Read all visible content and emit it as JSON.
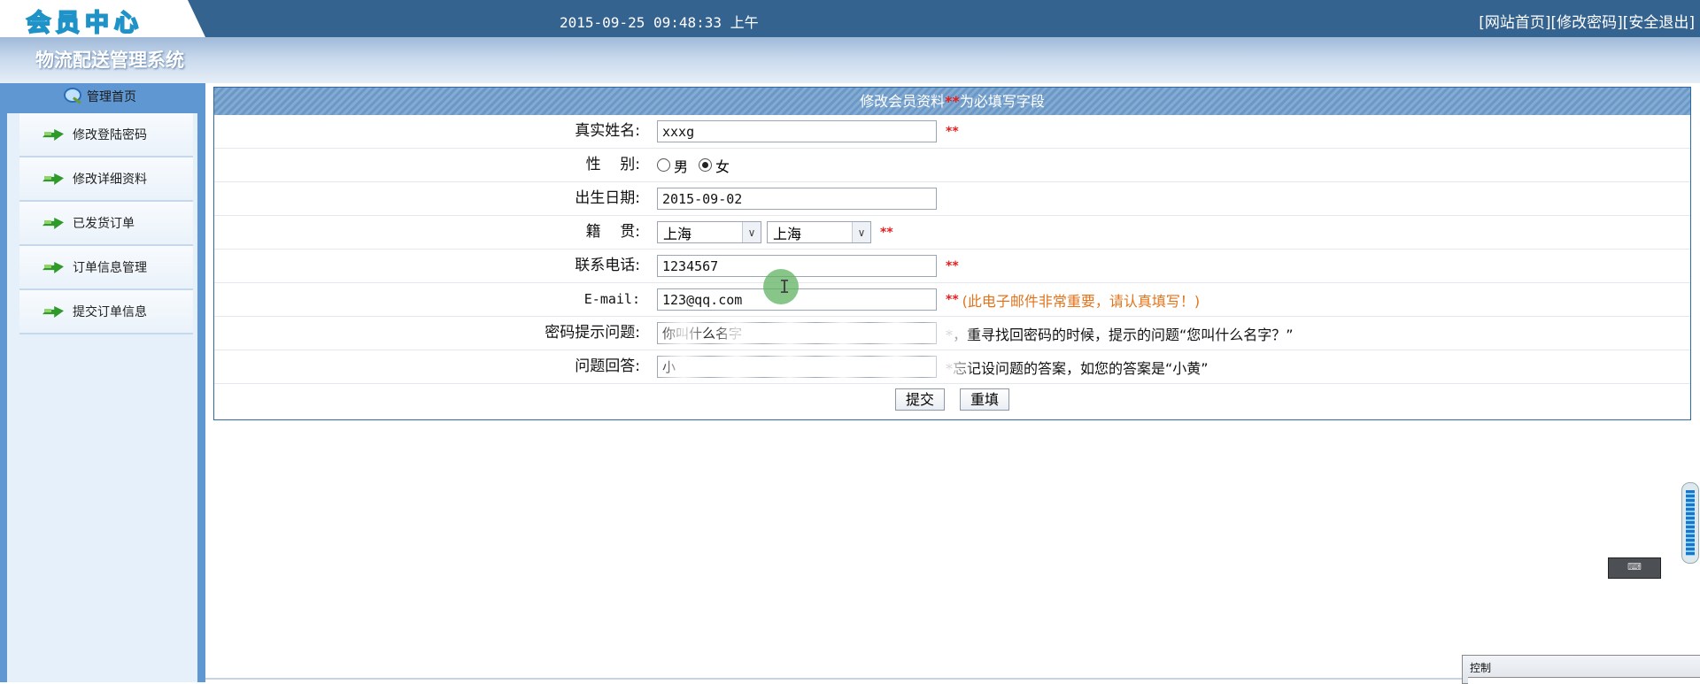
{
  "header": {
    "logo_text": "会员中心",
    "datetime": "2015-09-25 09:48:33 上午",
    "links": [
      "[网站首页]",
      "[修改密码]",
      "[安全退出]"
    ]
  },
  "system_title": "物流配送管理系统",
  "sidebar": {
    "home_label": "管理首页",
    "items": [
      {
        "label": "修改登陆密码"
      },
      {
        "label": "修改详细资料"
      },
      {
        "label": "已发货订单"
      },
      {
        "label": "订单信息管理"
      },
      {
        "label": "提交订单信息"
      }
    ]
  },
  "form": {
    "header_text": "修改会员资料",
    "header_req_mark": "**",
    "header_suffix": "为必填写字段",
    "req_mark": "**",
    "fields": {
      "real_name": {
        "label": "真实姓名:",
        "value": "xxxg"
      },
      "gender": {
        "label": "性    别:",
        "options": [
          "男",
          "女"
        ],
        "selected": "女"
      },
      "birth_date": {
        "label": "出生日期:",
        "value": "2015-09-02"
      },
      "native_place": {
        "label": "籍    贯:",
        "province": "上海",
        "city": "上海"
      },
      "phone": {
        "label": "联系电话:",
        "value": "1234567"
      },
      "email": {
        "label": "E-mail:",
        "value": "123@qq.com",
        "hint": "(此电子邮件非常重要，请认真填写！)"
      },
      "question": {
        "label": "密码提示问题:",
        "value": "你叫什么名字",
        "hint": "*，重寻找回密码的时候，提示的问题“您叫什么名字？”"
      },
      "answer": {
        "label": "问题回答:",
        "value": "小",
        "hint": "*忘记设问题的答案，如您的答案是“小黄”"
      }
    },
    "buttons": {
      "submit": "提交",
      "reset": "重填"
    }
  },
  "widgets": {
    "control_panel_label": "控制",
    "cursor_glyph": "I"
  },
  "colors": {
    "topbar": "#35638f",
    "sidebar_border": "#5f97d3",
    "required": "#e32020",
    "hint_orange": "#e0741c"
  }
}
